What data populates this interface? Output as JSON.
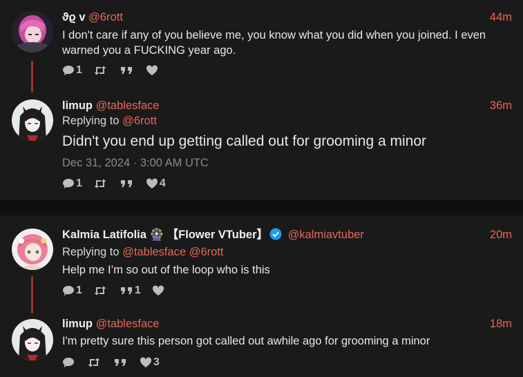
{
  "threads": [
    {
      "tweets": [
        {
          "name": "ϑϱ v",
          "handle": "@6rott",
          "time": "44m",
          "content": "I don't care if any of you believe me, you know what you did when you joined. I even warned you a FUCKING year ago.",
          "stats": {
            "replies": "1",
            "retweets": "",
            "quotes": "",
            "likes": ""
          }
        },
        {
          "name": "limup",
          "handle": "@tablesface",
          "time": "36m",
          "replying_label": "Replying to",
          "replying_to": "@6rott",
          "content": "Didn't you end up getting called out for grooming a minor",
          "date": "Dec 31, 2024 · 3:00 AM UTC",
          "stats": {
            "replies": "1",
            "retweets": "",
            "quotes": "",
            "likes": "4"
          }
        }
      ]
    },
    {
      "tweets": [
        {
          "name": "Kalmia Latifolia 🎡 【Flower VTuber】",
          "handle": "@kalmiavtuber",
          "verified": true,
          "time": "20m",
          "replying_label": "Replying to",
          "replying_to": "@tablesface @6rott",
          "content": "Help me I’m so out of the loop who is this",
          "stats": {
            "replies": "1",
            "retweets": "",
            "quotes": "1",
            "likes": ""
          }
        },
        {
          "name": "limup",
          "handle": "@tablesface",
          "time": "18m",
          "content": "I'm pretty sure this person got called out awhile ago for grooming a minor",
          "stats": {
            "replies": "",
            "retweets": "",
            "quotes": "",
            "likes": "3"
          }
        }
      ]
    }
  ],
  "colors": {
    "accent": "#e8675a",
    "thread_line": "#9b3232",
    "background": "#1a1a1a",
    "verified": "#1d9bf0"
  }
}
